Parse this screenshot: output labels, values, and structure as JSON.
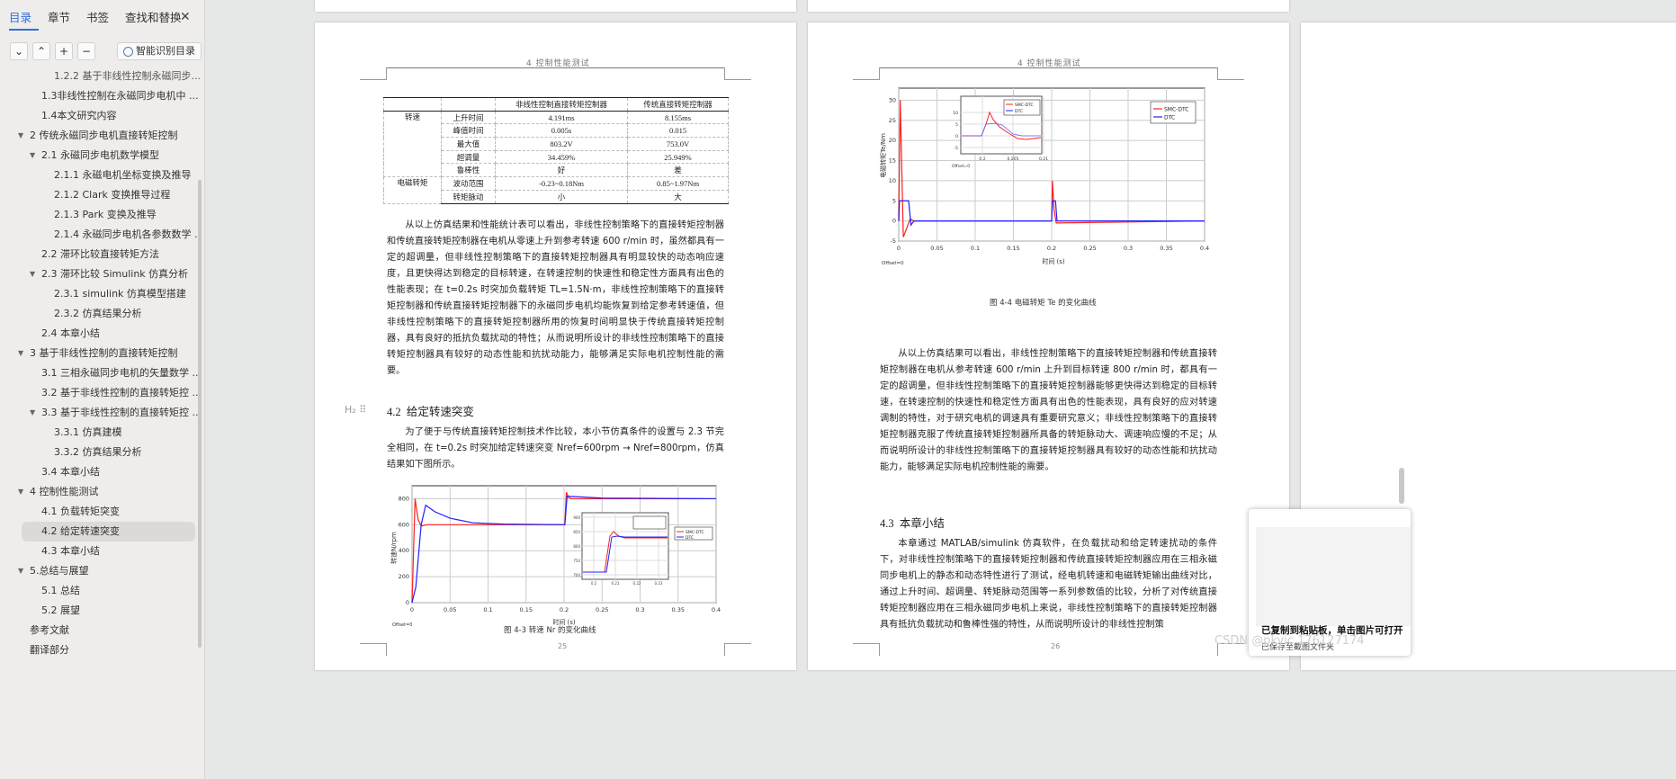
{
  "sidebar": {
    "tabs": [
      {
        "label": "目录",
        "active": true
      },
      {
        "label": "章节"
      },
      {
        "label": "书签"
      },
      {
        "label": "查找和替换"
      }
    ],
    "close_icon": "close-icon",
    "tools": {
      "collapse": "⌄",
      "expand": "⌃",
      "add": "+",
      "remove": "−",
      "smart_label": "智能识别目录"
    },
    "toc": [
      {
        "label": "1.2.2 基于非线性控制永磁同步...",
        "level": 3,
        "expand": false
      },
      {
        "label": "1.3非线性控制在永磁同步电机中 ...",
        "level": 2
      },
      {
        "label": "1.4本文研究内容",
        "level": 2
      },
      {
        "label": "2 传统永磁同步电机直接转矩控制",
        "level": 1,
        "expand": true
      },
      {
        "label": "2.1 永磁同步电机数学模型",
        "level": 2,
        "expand": true
      },
      {
        "label": "2.1.1 永磁电机坐标变换及推导",
        "level": 3
      },
      {
        "label": "2.1.2 Clark 变换推导过程",
        "level": 3
      },
      {
        "label": "2.1.3  Park 变换及推导",
        "level": 3
      },
      {
        "label": "2.1.4 永磁同步电机各参数数学 ...",
        "level": 3
      },
      {
        "label": "2.2 滞环比较直接转矩方法",
        "level": 2
      },
      {
        "label": "2.3 滞环比较 Simulink 仿真分析",
        "level": 2,
        "expand": true
      },
      {
        "label": "2.3.1 simulink 仿真模型搭建",
        "level": 3
      },
      {
        "label": "2.3.2 仿真结果分析",
        "level": 3
      },
      {
        "label": "2.4 本章小结",
        "level": 2
      },
      {
        "label": "3 基于非线性控制的直接转矩控制",
        "level": 1,
        "expand": true
      },
      {
        "label": "3.1 三相永磁同步电机的矢量数学 ...",
        "level": 2
      },
      {
        "label": "3.2 基于非线性控制的直接转矩控 ...",
        "level": 2
      },
      {
        "label": "3.3 基于非线性控制的直接转矩控 ...",
        "level": 2,
        "expand": true
      },
      {
        "label": "3.3.1 仿真建模",
        "level": 3
      },
      {
        "label": "3.3.2 仿真结果分析",
        "level": 3
      },
      {
        "label": "3.4 本章小结",
        "level": 2
      },
      {
        "label": "4 控制性能测试",
        "level": 1,
        "expand": true
      },
      {
        "label": "4.1 负载转矩突变",
        "level": 2
      },
      {
        "label": "4.2 给定转速突变",
        "level": 2,
        "selected": true
      },
      {
        "label": "4.3 本章小结",
        "level": 2
      },
      {
        "label": "5.总结与展望",
        "level": 1,
        "expand": true
      },
      {
        "label": "5.1 总结",
        "level": 2
      },
      {
        "label": "5.2 展望",
        "level": 2
      },
      {
        "label": "参考文献",
        "level": 1
      },
      {
        "label": "翻译部分",
        "level": 1
      }
    ]
  },
  "page25": {
    "header": "4 控制性能测试",
    "table": {
      "headers": [
        "",
        "",
        "非线性控制直接转矩控制器",
        "传统直接转矩控制器"
      ],
      "group_speed": "转速",
      "group_torque": "电磁转矩",
      "rows": [
        [
          "上升时间",
          "4.191ms",
          "8.155ms"
        ],
        [
          "峰值时间",
          "0.005s",
          "0.015"
        ],
        [
          "最大值",
          "803.2V",
          "753.0V"
        ],
        [
          "超调量",
          "34.459%",
          "25.949%"
        ],
        [
          "鲁棒性",
          "好",
          "差"
        ],
        [
          "波动范围",
          "-0.23~0.18Nm",
          "0.85~1.97Nm"
        ],
        [
          "转矩脉动",
          "小",
          "大"
        ]
      ]
    },
    "paragraph1": "从以上仿真结果和性能统计表可以看出，非线性控制策略下的直接转矩控制器和传统直接转矩控制器在电机从零速上升到参考转速 600 r/min 时，虽然都具有一定的超调量，但非线性控制策略下的直接转矩控制器具有明显较快的动态响应速度，且更快得达到稳定的目标转速，在转速控制的快速性和稳定性方面具有出色的性能表现；在 t=0.2s 时突加负载转矩 TL=1.5N·m，非线性控制策略下的直接转矩控制器和传统直接转矩控制器下的永磁同步电机均能恢复到给定参考转速值，但非线性控制策略下的直接转矩控制器所用的恢复时间明显快于传统直接转矩控制器，具有良好的抵抗负载扰动的特性；从而说明所设计的非线性控制策略下的直接转矩控制器具有较好的动态性能和抗扰动能力，能够满足实际电机控制性能的需要。",
    "heading_num": "4.2",
    "heading_text": "给定转速突变",
    "gutter_label": "H₂",
    "paragraph2": "为了便于与传统直接转矩控制技术作比较，本小节仿真条件的设置与 2.3 节完全相同，在 t=0.2s 时突加给定转速突变 Nref=600rpm → Nref=800rpm，仿真结果如下图所示。",
    "caption": "图 4-3  转速 Nr 的变化曲线",
    "page_number": "25"
  },
  "page26": {
    "header": "4 控制性能测试",
    "caption": "图 4-4  电磁转矩 Te 的变化曲线",
    "paragraph1": "从以上仿真结果可以看出，非线性控制策略下的直接转矩控制器和传统直接转矩控制器在电机从参考转速 600 r/min 上升到目标转速 800 r/min 时，都具有一定的超调量，但非线性控制策略下的直接转矩控制器能够更快得达到稳定的目标转速，在转速控制的快速性和稳定性方面具有出色的性能表现，具有良好的应对转速调制的特性，对于研究电机的调速具有重要研究意义；非线性控制策略下的直接转矩控制器克服了传统直接转矩控制器所具备的转矩脉动大、调速响应慢的不足；从而说明所设计的非线性控制策略下的直接转矩控制器具有较好的动态性能和抗扰动能力，能够满足实际电机控制性能的需要。",
    "heading_num": "4.3",
    "heading_text": "本章小结",
    "paragraph2": "本章通过 MATLAB/simulink 仿真软件，在负载扰动和给定转速扰动的条件下，对非线性控制策略下的直接转矩控制器和传统直接转矩控制器应用在三相永磁同步电机上的静态和动态特性进行了测试，经电机转速和电磁转矩输出曲线对比，通过上升时间、超调量、转矩脉动范围等一系列参数值的比较，分析了对传统直接转矩控制器应用在三相永磁同步电机上来说，非线性控制策略下的直接转矩控制器具有抵抗负载扰动和鲁棒性强的特性，从而说明所设计的非线性控制策",
    "page_number": "26"
  },
  "chart_data": [
    {
      "type": "line",
      "title": "图 4-3 转速 Nr 的变化曲线",
      "xlabel": "时间 (s)",
      "ylabel": "转速N/rpm",
      "xlim": [
        0,
        0.4
      ],
      "ylim": [
        0,
        900
      ],
      "xticks": [
        "0",
        "0.05",
        "0.1",
        "0.15",
        "0.2",
        "0.25",
        "0.3",
        "0.35",
        "0.4"
      ],
      "yticks": [
        "0",
        "200",
        "400",
        "600",
        "800"
      ],
      "offset_label": "Offset=0",
      "legend": [
        "SMC-DTC",
        "DTC"
      ],
      "series": [
        {
          "name": "SMC-DTC",
          "color": "#ff2020",
          "x": [
            0,
            0.004,
            0.008,
            0.012,
            0.02,
            0.05,
            0.1,
            0.2,
            0.201,
            0.203,
            0.206,
            0.21,
            0.25,
            0.4
          ],
          "y": [
            0,
            800,
            640,
            590,
            600,
            600,
            600,
            600,
            600,
            850,
            810,
            800,
            800,
            800
          ]
        },
        {
          "name": "DTC",
          "color": "#2020ff",
          "x": [
            0,
            0.005,
            0.012,
            0.018,
            0.03,
            0.05,
            0.08,
            0.12,
            0.2,
            0.201,
            0.204,
            0.208,
            0.25,
            0.4
          ],
          "y": [
            0,
            120,
            600,
            750,
            700,
            650,
            615,
            605,
            600,
            600,
            820,
            818,
            805,
            800
          ]
        }
      ],
      "inset": {
        "xticks": [
          "0.2",
          "0.21",
          "0.22",
          "0.23"
        ],
        "yticks": [
          "700",
          "750",
          "800",
          "850",
          "900"
        ],
        "legend": [
          "SMC-DTC",
          "DTC"
        ]
      }
    },
    {
      "type": "line",
      "title": "图 4-4 电磁转矩 Te 的变化曲线",
      "xlabel": "时间 (s)",
      "ylabel": "电磁转矩Te/Nm",
      "xlim": [
        0,
        0.4
      ],
      "ylim": [
        -5,
        33
      ],
      "xticks": [
        "0",
        "0.05",
        "0.1",
        "0.15",
        "0.2",
        "0.25",
        "0.3",
        "0.35",
        "0.4"
      ],
      "yticks": [
        "-5",
        "0",
        "5",
        "10",
        "15",
        "20",
        "25",
        "30"
      ],
      "offset_label": "Offset=0",
      "legend": [
        "SMC-DTC",
        "DTC"
      ],
      "series": [
        {
          "name": "SMC-DTC",
          "color": "#ff2020",
          "x": [
            0,
            0.002,
            0.006,
            0.01,
            0.015,
            0.02,
            0.2,
            0.201,
            0.203,
            0.206,
            0.4
          ],
          "y": [
            0,
            30,
            -4,
            -2,
            0.5,
            0,
            0,
            10,
            3,
            -0.5,
            0
          ]
        },
        {
          "name": "DTC",
          "color": "#2020ff",
          "x": [
            0,
            0.001,
            0.013,
            0.016,
            0.02,
            0.2,
            0.201,
            0.205,
            0.207,
            0.4
          ],
          "y": [
            0,
            5,
            5,
            -1,
            0,
            0,
            5,
            5,
            0,
            0
          ]
        }
      ],
      "inset": {
        "xticks": [
          "0.2",
          "0.205",
          "0.21"
        ],
        "yticks": [
          "-5",
          "0",
          "5",
          "10"
        ],
        "legend": [
          "SMC-DTC",
          "DTC"
        ],
        "offset_label": "Offset=0"
      }
    }
  ],
  "clipboard_popup": {
    "message": "已复制到粘贴板，单击图片可打开",
    "sub": "已保存至截图文件夹"
  },
  "watermark": "CSDN @pkyic 176127174"
}
